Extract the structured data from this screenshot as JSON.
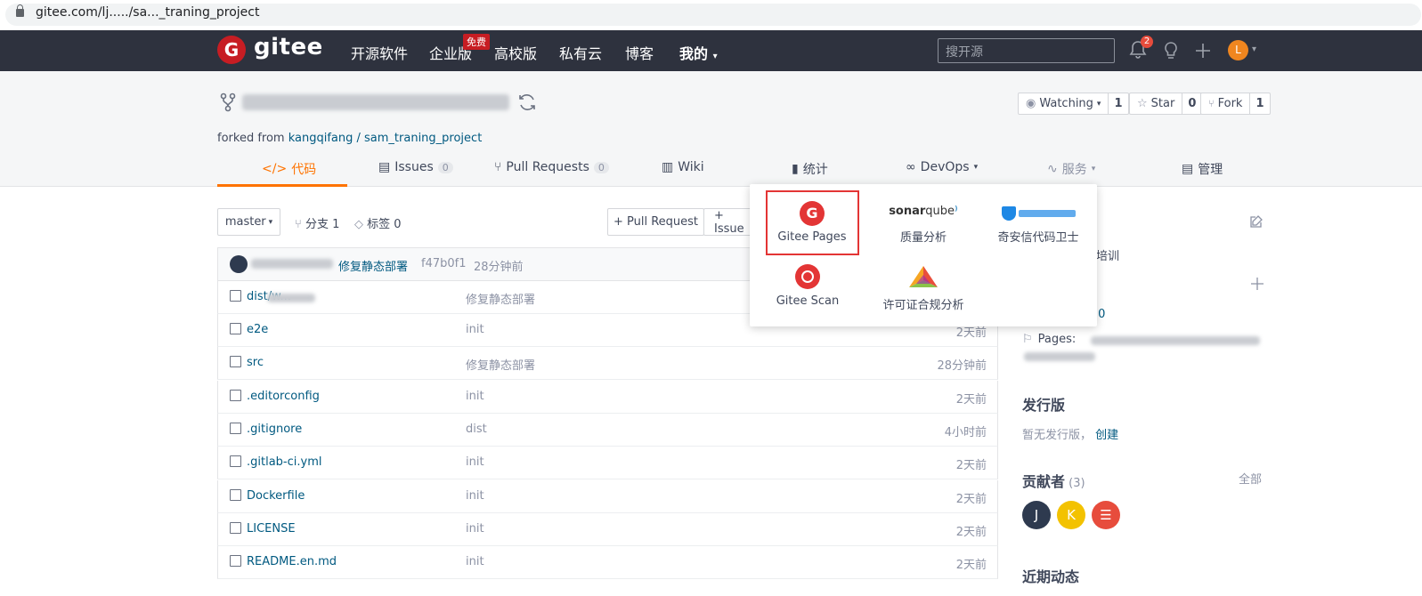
{
  "browser": {
    "url": "gitee.com/lj...../sa..._traning_project"
  },
  "nav": {
    "logo": "gitee",
    "items": [
      "开源软件",
      "企业版",
      "高校版",
      "私有云",
      "博客",
      "我的"
    ],
    "free_badge": "免费",
    "search_placeholder": "搜开源",
    "notifications": "2",
    "user_initial": "L"
  },
  "repo": {
    "sync_icon": "sync-icon",
    "forked_prefix": "forked from",
    "forked_link": "kangqifang / sam_traning_project",
    "watching": {
      "label": "Watching",
      "count": "1"
    },
    "star": {
      "label": "Star",
      "count": "0"
    },
    "fork": {
      "label": "Fork",
      "count": "1"
    }
  },
  "tabs": [
    {
      "label": "代码",
      "icon": "code-icon"
    },
    {
      "label": "Issues",
      "count": "0"
    },
    {
      "label": "Pull Requests",
      "count": "0"
    },
    {
      "label": "Wiki"
    },
    {
      "label": "统计"
    },
    {
      "label": "DevOps"
    },
    {
      "label": "服务"
    },
    {
      "label": "管理"
    }
  ],
  "toolbar": {
    "branch": "master",
    "branches": "分支 1",
    "tags": "标签 0",
    "pull_request": "+ Pull Request",
    "issue": "+ Issue"
  },
  "commit": {
    "message": "修复静态部署",
    "hash": "f47b0f1",
    "time": "28分钟前"
  },
  "files": [
    {
      "name": "dist/w...",
      "type": "folder",
      "message": "修复静态部署",
      "time": ""
    },
    {
      "name": "e2e",
      "type": "folder",
      "message": "init",
      "time": "2天前"
    },
    {
      "name": "src",
      "type": "folder",
      "message": "修复静态部署",
      "time": "28分钟前"
    },
    {
      "name": ".editorconfig",
      "type": "file",
      "message": "init",
      "time": "2天前"
    },
    {
      "name": ".gitignore",
      "type": "file",
      "message": "dist",
      "time": "4小时前"
    },
    {
      "name": ".gitlab-ci.yml",
      "type": "file",
      "message": "init",
      "time": "2天前"
    },
    {
      "name": "Dockerfile",
      "type": "file",
      "message": "init",
      "time": "2天前"
    },
    {
      "name": "LICENSE",
      "type": "file",
      "message": "init",
      "time": "2天前"
    },
    {
      "name": "README.en.md",
      "type": "file",
      "message": "init",
      "time": "2天前"
    }
  ],
  "services": [
    {
      "label": "Gitee Pages",
      "icon": "gitee-pages-icon"
    },
    {
      "label": "质量分析",
      "icon": "sonarqube-logo"
    },
    {
      "label": "奇安信代码卫士",
      "icon": "qianxin-logo"
    },
    {
      "label": "Gitee Scan",
      "icon": "gitee-scan-icon"
    },
    {
      "label": "许可证合规分析",
      "icon": "license-compliance-icon"
    }
  ],
  "sidebar": {
    "desc_fragment": "培训",
    "version_fragment": ".0",
    "pages_label": "Pages:",
    "releases_title": "发行版",
    "releases_empty": "暂无发行版，",
    "releases_create": "创建",
    "contributors_title": "贡献者",
    "contributors_count": "(3)",
    "contributors_all": "全部",
    "contributors": [
      {
        "initial": "J",
        "color": "#2e3a4f"
      },
      {
        "initial": "K",
        "color": "#f3c200"
      },
      {
        "initial": "☰",
        "color": "#e74c3c"
      }
    ],
    "activity_title": "近期动态"
  }
}
